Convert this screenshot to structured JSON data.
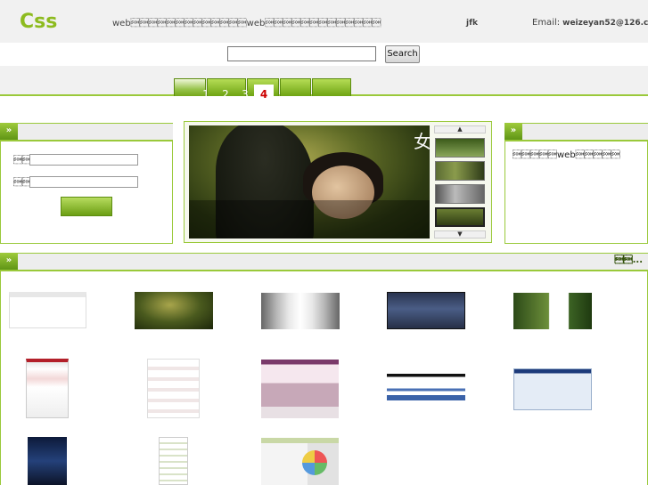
{
  "header": {
    "logo": "Css",
    "slogan": "web\u0001\u0001\u0001\u0001\u0001\u0001\u0001\u0001\u0001\u0001\u0001\u0001\u0001web\u0001\u0001\u0001\u0001\u0001\u0001\u0001\u0001\u0001\u0001\u0001\u0001\u0001",
    "user": "jfk",
    "email_label": "Email:",
    "email_value": "weizeyan52@126.com"
  },
  "search": {
    "placeholder": "",
    "button_label": "Search"
  },
  "nav": {
    "tab_count": 6,
    "active_tab_index": 0
  },
  "login": {
    "badge": "»",
    "username_label": "\u0001\u0001\u0001",
    "password_label": "\u0001\u0001\u0001",
    "username_value": "",
    "password_value": ""
  },
  "carousel": {
    "slide_glyph": "女",
    "numbers": [
      "1",
      "2",
      "3",
      "4"
    ],
    "active_number": "4",
    "up_arrow": "▲",
    "down_arrow": "▼"
  },
  "intro": {
    "badge": "»",
    "text": "\u0001\u0001\u0001\u0001\u0001web\u0001\u0001\u0001\u0001\u0001"
  },
  "gallery": {
    "badge": "»",
    "more_label": "\u0001\u0001...",
    "items": [
      "thumb-1",
      "thumb-2",
      "thumb-3",
      "thumb-4",
      "thumb-5",
      "thumb-6",
      "thumb-7",
      "thumb-8",
      "thumb-9",
      "thumb-10",
      "thumb-11",
      "thumb-12",
      "thumb-13"
    ]
  },
  "colors": {
    "accent": "#9ac93a",
    "accent_dark": "#5f9515",
    "logo": "#8dbb1f",
    "band": "#f1f1f1"
  }
}
